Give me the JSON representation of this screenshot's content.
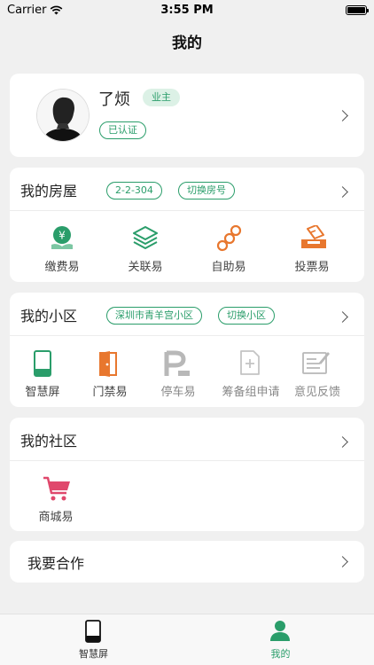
{
  "status_bar": {
    "carrier": "Carrier",
    "time": "3:55 PM"
  },
  "nav": {
    "title": "我的"
  },
  "profile": {
    "name": "了烦",
    "role_badge": "业主",
    "verified_badge": "已认证"
  },
  "house": {
    "title": "我的房屋",
    "room": "2-2-304",
    "switch_label": "切换房号",
    "items": [
      {
        "label": "缴费易",
        "icon": "payment-icon"
      },
      {
        "label": "关联易",
        "icon": "layers-icon"
      },
      {
        "label": "自助易",
        "icon": "self-service-icon"
      },
      {
        "label": "投票易",
        "icon": "vote-icon"
      }
    ]
  },
  "community": {
    "title": "我的小区",
    "name": "深圳市青羊宫小区",
    "switch_label": "切换小区",
    "items": [
      {
        "label": "智慧屏",
        "icon": "smart-screen-icon"
      },
      {
        "label": "门禁易",
        "icon": "door-icon"
      },
      {
        "label": "停车易",
        "icon": "parking-icon"
      },
      {
        "label": "筹备组申请",
        "icon": "application-icon"
      },
      {
        "label": "意见反馈",
        "icon": "feedback-icon"
      }
    ]
  },
  "society": {
    "title": "我的社区",
    "items": [
      {
        "label": "商城易",
        "icon": "cart-icon"
      }
    ]
  },
  "cooperation": {
    "title": "我要合作"
  },
  "tabbar": {
    "tabs": [
      {
        "label": "智慧屏",
        "icon": "smart-screen-icon"
      },
      {
        "label": "我的",
        "icon": "user-icon",
        "active": true
      }
    ]
  },
  "colors": {
    "accent": "#2a9d6a",
    "orange": "#e8772e",
    "gray_icon": "#b8b8b8"
  }
}
